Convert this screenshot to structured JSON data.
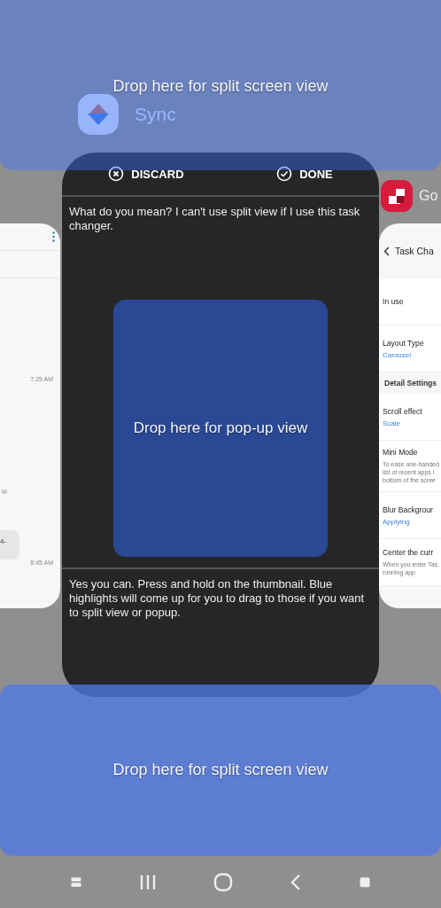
{
  "left_card": {
    "items": [
      {
        "kind": "time",
        "text": "7:25 AM"
      },
      {
        "kind": "time",
        "text": "M"
      },
      {
        "kind": "bubble",
        "text": "4-"
      },
      {
        "kind": "time",
        "text": "8:45 AM"
      }
    ]
  },
  "center_card": {
    "app": "Sync",
    "actions": [
      {
        "kind": "discard",
        "label": "DISCARD"
      },
      {
        "kind": "done",
        "label": "DONE"
      }
    ],
    "question": "What do you mean? I can't use split view if I use this task changer.",
    "answer": "Yes you can. Press and hold on the thumbnail. Blue highlights will come up for you to drag to those if you want to split view or popup."
  },
  "right_card": {
    "app": "Go",
    "title": "Task Cha",
    "items": [
      {
        "kind": "row",
        "title": "In use"
      },
      {
        "kind": "row",
        "title": "Layout Type",
        "value": "Carousel"
      },
      {
        "kind": "header",
        "title": "Detail Settings"
      },
      {
        "kind": "row",
        "title": "Scroll effect",
        "value": "Scale"
      },
      {
        "kind": "row",
        "title": "Mini Mode",
        "desc": [
          "To ease one-handed",
          "list of recent apps i",
          "bottom of the scree"
        ]
      },
      {
        "kind": "row",
        "title": "Blur Backgrour",
        "value": "Applying"
      },
      {
        "kind": "row",
        "title": "Center the curr",
        "desc": [
          "When you enter Tas",
          "running app."
        ]
      }
    ]
  },
  "drop_zones": [
    {
      "kind": "top",
      "label": "Drop here for split screen view"
    },
    {
      "kind": "popup",
      "label": "Drop here for pop-up view"
    },
    {
      "kind": "bottom",
      "label": "Drop here for split screen view"
    }
  ],
  "nav_bar": [
    {
      "kind": "pin"
    },
    {
      "kind": "recents"
    },
    {
      "kind": "home"
    },
    {
      "kind": "back"
    },
    {
      "kind": "square"
    }
  ]
}
